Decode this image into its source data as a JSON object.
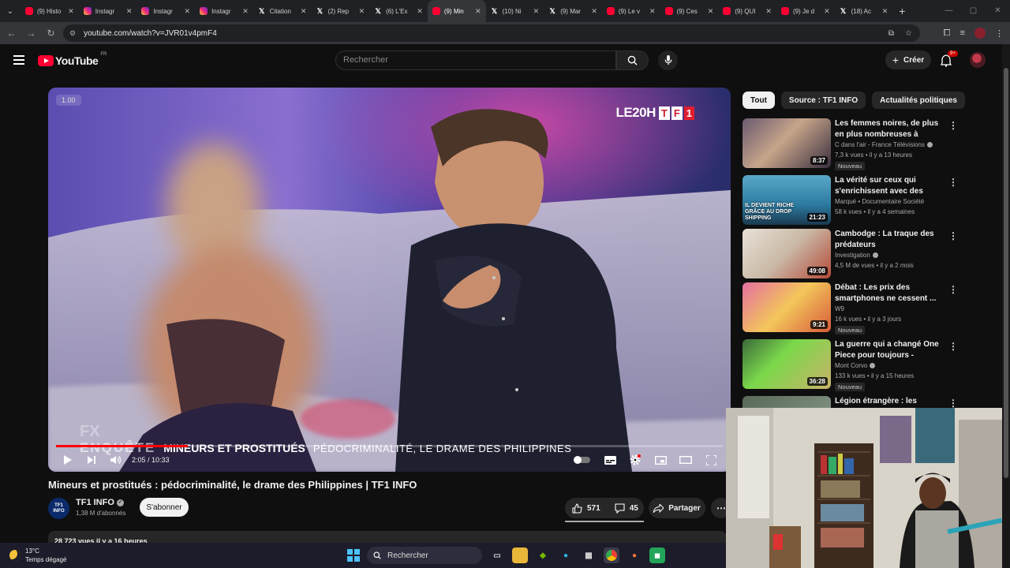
{
  "browser": {
    "tabs": [
      {
        "label": "(9) Histo",
        "icon": "youtube"
      },
      {
        "label": "Instagr",
        "icon": "instagram"
      },
      {
        "label": "Instagr",
        "icon": "instagram"
      },
      {
        "label": "Instagr",
        "icon": "instagram"
      },
      {
        "label": "Citation",
        "icon": "x"
      },
      {
        "label": "(2) Rep",
        "icon": "x"
      },
      {
        "label": "(6) L'Ex",
        "icon": "x"
      },
      {
        "label": "(9) Min",
        "icon": "youtube",
        "active": true
      },
      {
        "label": "(10) Ni",
        "icon": "x"
      },
      {
        "label": "(9) Mar",
        "icon": "x"
      },
      {
        "label": "(9) Le v",
        "icon": "youtube"
      },
      {
        "label": "(9) Ces",
        "icon": "youtube"
      },
      {
        "label": "(9) QUI",
        "icon": "youtube"
      },
      {
        "label": "(9) Je d",
        "icon": "youtube"
      },
      {
        "label": "(18) Ac",
        "icon": "x"
      }
    ],
    "url": "youtube.com/watch?v=JVR01v4pmF4"
  },
  "header": {
    "logo_text": "YouTube",
    "country": "FR",
    "search_placeholder": "Rechercher",
    "create_label": "Créer",
    "notif_badge": "9+"
  },
  "player": {
    "speed": "1.00",
    "brand_text": "LE20H",
    "brand_channel": "TF1",
    "chyron_fx": "FX",
    "chyron_enquete": "ENQUÊTE",
    "chyron_main": "MINEURS ET PROSTITUÉS",
    "chyron_sub": "PÉDOCRIMINALITÉ, LE DRAME DES PHILIPPINES",
    "time": "2:05 / 10:33",
    "progress_fraction": 0.198
  },
  "video": {
    "title": "Mineurs et prostitués : pédocriminalité, le drame des Philippines  | TF1 INFO",
    "channel": "TF1 INFO",
    "channel_avatar_text_1": "TF1",
    "channel_avatar_text_2": "INFO",
    "subscribers": "1,38 M d'abonnés",
    "subscribe_label": "S'abonner",
    "likes": "571",
    "comments": "45",
    "share_label": "Partager",
    "description_preview": "28 723 vues  il y a 16 heures"
  },
  "chips": [
    "Tout",
    "Source : TF1 INFO",
    "Actualités politiques"
  ],
  "recommendations": [
    {
      "title": "Les femmes noires, de plus en plus nombreuses à s'armer à ...",
      "channel": "C dans l'air - France Télévisions",
      "verified": true,
      "views": "7,3 k vues",
      "age": "il y a 13 heures",
      "duration": "8:37",
      "badge": "Nouveau"
    },
    {
      "title": "La vérité sur ceux qui s'enrichissent avec des produi...",
      "channel": "Marqué",
      "channel_extra": "Documentaire Société",
      "verified": false,
      "views": "58 k vues",
      "age": "il y a 4 semaines",
      "duration": "21:23",
      "badge": "",
      "thumb_text": "IL DEVIENT RICHE GRÂCE AU DROP SHIPPING"
    },
    {
      "title": "Cambodge : La traque des prédateurs",
      "channel": "Investigation",
      "verified": true,
      "views": "4,5 M de vues",
      "age": "il y a 2 mois",
      "duration": "49:08",
      "badge": ""
    },
    {
      "title": "Débat : Les prix des smartphones ne cessent ...",
      "channel": "W9",
      "verified": false,
      "views": "16 k vues",
      "age": "il y a 3 jours",
      "duration": "9:21",
      "badge": "Nouveau"
    },
    {
      "title": "La guerre qui a changé One Piece pour toujours  - Chapitre...",
      "channel": "Mont Corvo",
      "verified": true,
      "views": "133 k vues",
      "age": "il y a 15 heures",
      "duration": "36:28",
      "badge": "Nouveau"
    },
    {
      "title": "Légion étrangère : les premiers",
      "channel": "",
      "verified": false,
      "views": "",
      "age": "",
      "duration": "",
      "badge": ""
    }
  ],
  "taskbar": {
    "temperature": "13°C",
    "weather": "Temps dégagé",
    "search_label": "Rechercher"
  },
  "colors": {
    "accent": "#ff0033",
    "bg": "#0f0f0f",
    "chip_active": "#f1f1f1"
  }
}
